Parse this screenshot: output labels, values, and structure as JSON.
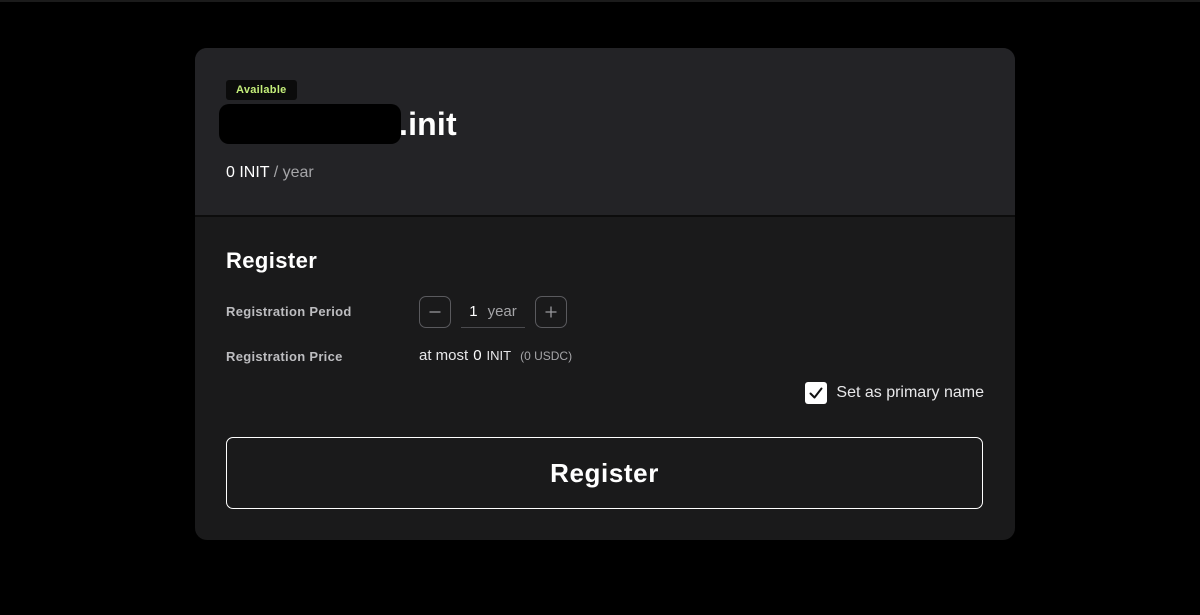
{
  "domain": {
    "status_badge": "Available",
    "suffix": ".init",
    "price_amount": "0 INIT",
    "price_period": "/ year"
  },
  "register": {
    "title": "Register",
    "period_label": "Registration Period",
    "period_value": "1",
    "period_unit": "year",
    "decrement_symbol": "−",
    "increment_symbol": "+",
    "price_label": "Registration Price",
    "price_prefix": "at most",
    "price_value": "0",
    "price_unit": "INIT",
    "price_usd": "(0 USDC)",
    "primary_label": "Set as primary name",
    "primary_checked": true,
    "button_label": "Register"
  },
  "colors": {
    "background": "#000000",
    "card_top": "#232326",
    "card_bottom": "#1a1a1b",
    "badge_text": "#c4ee7a"
  },
  "icons": {
    "minus": "minus-icon",
    "plus": "plus-icon",
    "check": "checkmark-icon"
  }
}
